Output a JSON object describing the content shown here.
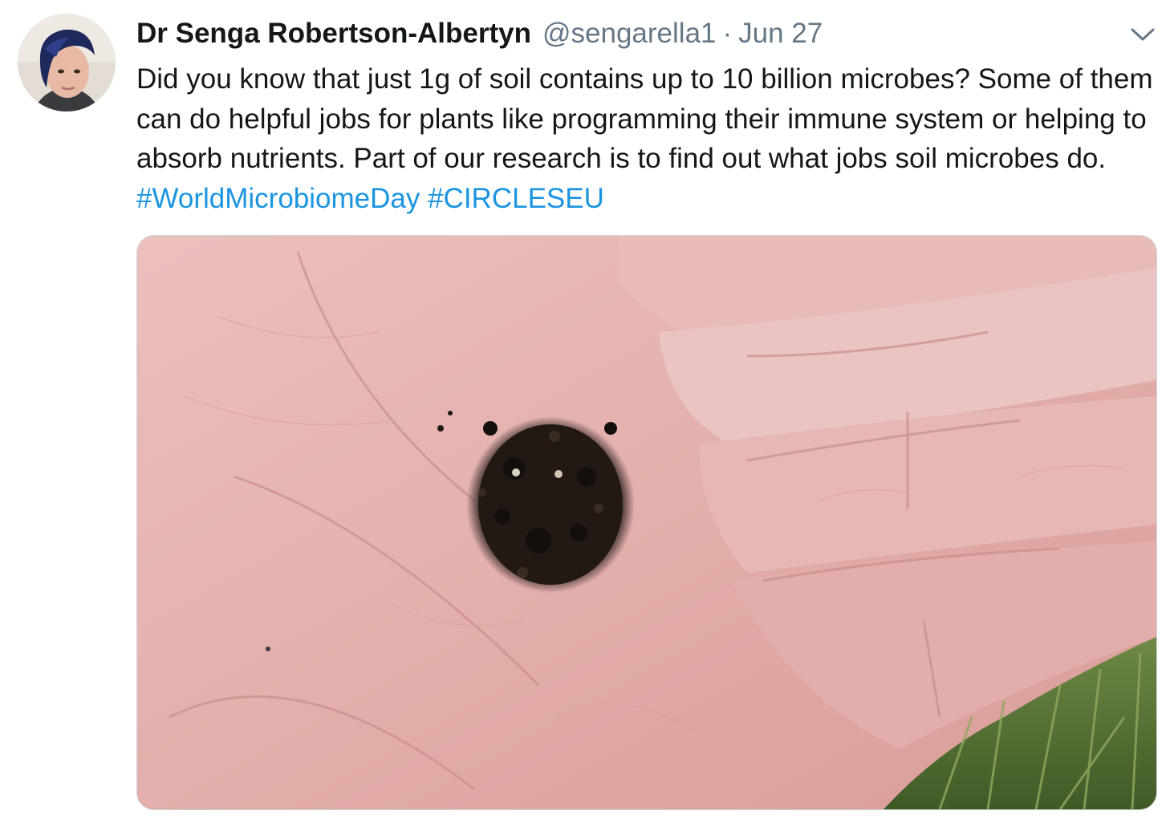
{
  "tweet": {
    "author": {
      "display_name": "Dr Senga Robertson-Albertyn",
      "handle": "@sengarella1"
    },
    "separator": "·",
    "date": "Jun 27",
    "text_main": "Did you know that just 1g of soil contains up to 10 billion microbes? Some of them can do helpful jobs for plants like programming their immune system or helping to absorb nutrients. Part of our research is to find out what jobs soil microbes do.",
    "hashtags": [
      "#WorldMicrobiomeDay",
      "#CIRCLESEU"
    ],
    "media": {
      "icon": "photo-of-soil-in-palm"
    },
    "menu_icon": "chevron-down-icon"
  },
  "colors": {
    "text": "#14171a",
    "secondary": "#657786",
    "link": "#1b95e0",
    "border": "#ccd6dd"
  }
}
